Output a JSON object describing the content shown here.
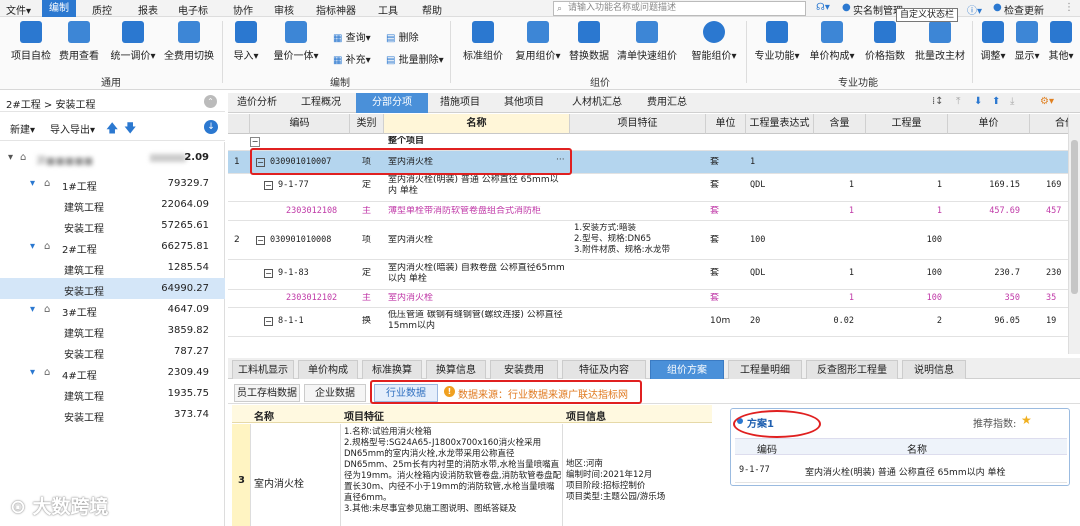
{
  "menubar": {
    "items": [
      "文件▾",
      "编制",
      "质控",
      "报表",
      "电子标",
      "协作",
      "审核",
      "指标神器",
      "工具",
      "帮助"
    ],
    "active_index": 1,
    "search_placeholder": "请输入功能名称或问题描述",
    "user": "实名制管理",
    "check_update": "检查更新",
    "tooltip": "自定义状态栏"
  },
  "ribbon": {
    "groups": [
      {
        "label": "通用",
        "buttons": [
          "项目自检",
          "费用查看",
          "统一调价▾",
          "全费用切换"
        ]
      },
      {
        "label": "编制",
        "buttons": [
          "导入▾",
          "量价一体▾"
        ],
        "small": [
          "查询▾",
          "删除",
          "补充▾",
          "批量删除▾"
        ]
      },
      {
        "label": "组价",
        "buttons": [
          "标准组价",
          "复用组价▾",
          "替换数据",
          "清单快速组价",
          "智能组价▾"
        ]
      },
      {
        "label": "专业功能",
        "buttons": [
          "专业功能▾",
          "单价构成▾",
          "价格指数",
          "批量改主材"
        ]
      },
      {
        "label": "",
        "buttons": [
          "调整▾",
          "显示▾",
          "其他▾"
        ]
      }
    ]
  },
  "left_panel": {
    "breadcrumb": "2#工程 > 安装工程",
    "toolbar": {
      "new": "新建▾",
      "import_export": "导入导出▾"
    },
    "tree": [
      {
        "label": "源■■■■■",
        "value": "2.09",
        "level": 0,
        "blurred": true
      },
      {
        "label": "1#工程",
        "value": "79329.7",
        "level": 1
      },
      {
        "label": "建筑工程",
        "value": "22064.09",
        "level": 2
      },
      {
        "label": "安装工程",
        "value": "57265.61",
        "level": 2
      },
      {
        "label": "2#工程",
        "value": "66275.81",
        "level": 1
      },
      {
        "label": "建筑工程",
        "value": "1285.54",
        "level": 2
      },
      {
        "label": "安装工程",
        "value": "64990.27",
        "level": 2,
        "selected": true
      },
      {
        "label": "3#工程",
        "value": "4647.09",
        "level": 1
      },
      {
        "label": "建筑工程",
        "value": "3859.82",
        "level": 2
      },
      {
        "label": "安装工程",
        "value": "787.27",
        "level": 2
      },
      {
        "label": "4#工程",
        "value": "2309.49",
        "level": 1
      },
      {
        "label": "建筑工程",
        "value": "1935.75",
        "level": 2
      },
      {
        "label": "安装工程",
        "value": "373.74",
        "level": 2
      }
    ]
  },
  "tabs": {
    "items": [
      "造价分析",
      "工程概况",
      "分部分项",
      "措施项目",
      "其他项目",
      "人材机汇总",
      "费用汇总"
    ],
    "active_index": 2
  },
  "grid": {
    "headers": [
      "编码",
      "类别",
      "名称",
      "项目特征",
      "单位",
      "工程量表达式",
      "含量",
      "工程量",
      "单价",
      "合价"
    ],
    "section_row": "整个项目",
    "rows": [
      {
        "num": "1",
        "code": "030901010007",
        "type": "项",
        "name": "室内消火栓",
        "feature": "",
        "unit": "套",
        "expr": "1",
        "content": "",
        "qty": "",
        "price": "",
        "total": ""
      },
      {
        "num": "",
        "code": "9-1-77",
        "type": "定",
        "name": "室内消火栓(明装) 普通 公称直径 65mm以内 单栓",
        "feature": "",
        "unit": "套",
        "expr": "QDL",
        "content": "1",
        "qty": "1",
        "price": "169.15",
        "total": "169"
      },
      {
        "num": "",
        "code": "2303012108",
        "type": "主",
        "name": "薄型单栓带消防软管卷盘组合式消防柜",
        "feature": "",
        "unit": "套",
        "expr": "",
        "content": "1",
        "qty": "1",
        "price": "457.69",
        "total": "457"
      },
      {
        "num": "2",
        "code": "030901010008",
        "type": "项",
        "name": "室内消火栓",
        "feature": "1.安装方式:暗装\n2.型号、规格:DN65\n3.附件材质、规格:水龙带",
        "unit": "套",
        "expr": "100",
        "content": "",
        "qty": "100",
        "price": "",
        "total": ""
      },
      {
        "num": "",
        "code": "9-1-83",
        "type": "定",
        "name": "室内消火栓(暗装) 自救卷盘 公称直径65mm以内 单栓",
        "feature": "",
        "unit": "套",
        "expr": "QDL",
        "content": "1",
        "qty": "100",
        "price": "230.7",
        "total": "230"
      },
      {
        "num": "",
        "code": "2303012102",
        "type": "主",
        "name": "室内消火栓",
        "feature": "",
        "unit": "套",
        "expr": "",
        "content": "1",
        "qty": "100",
        "price": "350",
        "total": "35"
      },
      {
        "num": "",
        "code": "8-1-1",
        "type": "换",
        "name": "低压管道 碳钢有缝钢管(螺纹连接) 公称直径15mm以内",
        "feature": "",
        "unit": "10m",
        "expr": "20",
        "content": "0.02",
        "qty": "2",
        "price": "96.05",
        "total": "19"
      }
    ]
  },
  "bottom_tabs": {
    "items": [
      "工料机显示",
      "单价构成",
      "标准换算",
      "换算信息",
      "安装费用",
      "特征及内容",
      "组价方案",
      "工程量明细",
      "反查图形工程量",
      "说明信息"
    ],
    "active_index": 6
  },
  "sub_tabs": {
    "items": [
      "员工存档数据",
      "企业数据",
      "行业数据"
    ],
    "active_index": 2,
    "source_note": "数据来源：行业数据来源广联达指标网"
  },
  "bottom_table": {
    "headers": [
      "名称",
      "项目特征",
      "项目信息"
    ],
    "row": {
      "num": "3",
      "name": "室内消火栓",
      "feature": "1.名称:试验用消火栓箱\n2.规格型号:SG24A65-J1800x700x160消火栓采用DN65mm的室内消火栓,水龙带采用公称直径DN65mm、25m长有内衬里的消防水带,水枪当量喷嘴直径为19mm。消火栓箱内设消防软管卷盘,消防软管卷盘配置长30m、内径不小于19mm的消防软管,水枪当量喷嘴直径6mm。\n3.其他:未尽事宜参见施工图说明、图纸答疑及",
      "info": "地区:河南\n编制时间:2021年12月\n项目阶段:招标控制价\n项目类型:主题公园/游乐场"
    }
  },
  "scheme_panel": {
    "title": "方案1",
    "recommend_label": "推荐指数:",
    "headers": [
      "编码",
      "名称"
    ],
    "rows": [
      {
        "code": "9-1-77",
        "name": "室内消火栓(明装) 普通 公称直径 65mm以内 单栓"
      }
    ]
  },
  "watermark": "大数跨境",
  "colors": {
    "accent": "#2b78d0",
    "tab_active": "#4a90d9",
    "highlight": "#e02020",
    "main_material": "#c03aa8",
    "selected_row": "#b4d5ee"
  }
}
